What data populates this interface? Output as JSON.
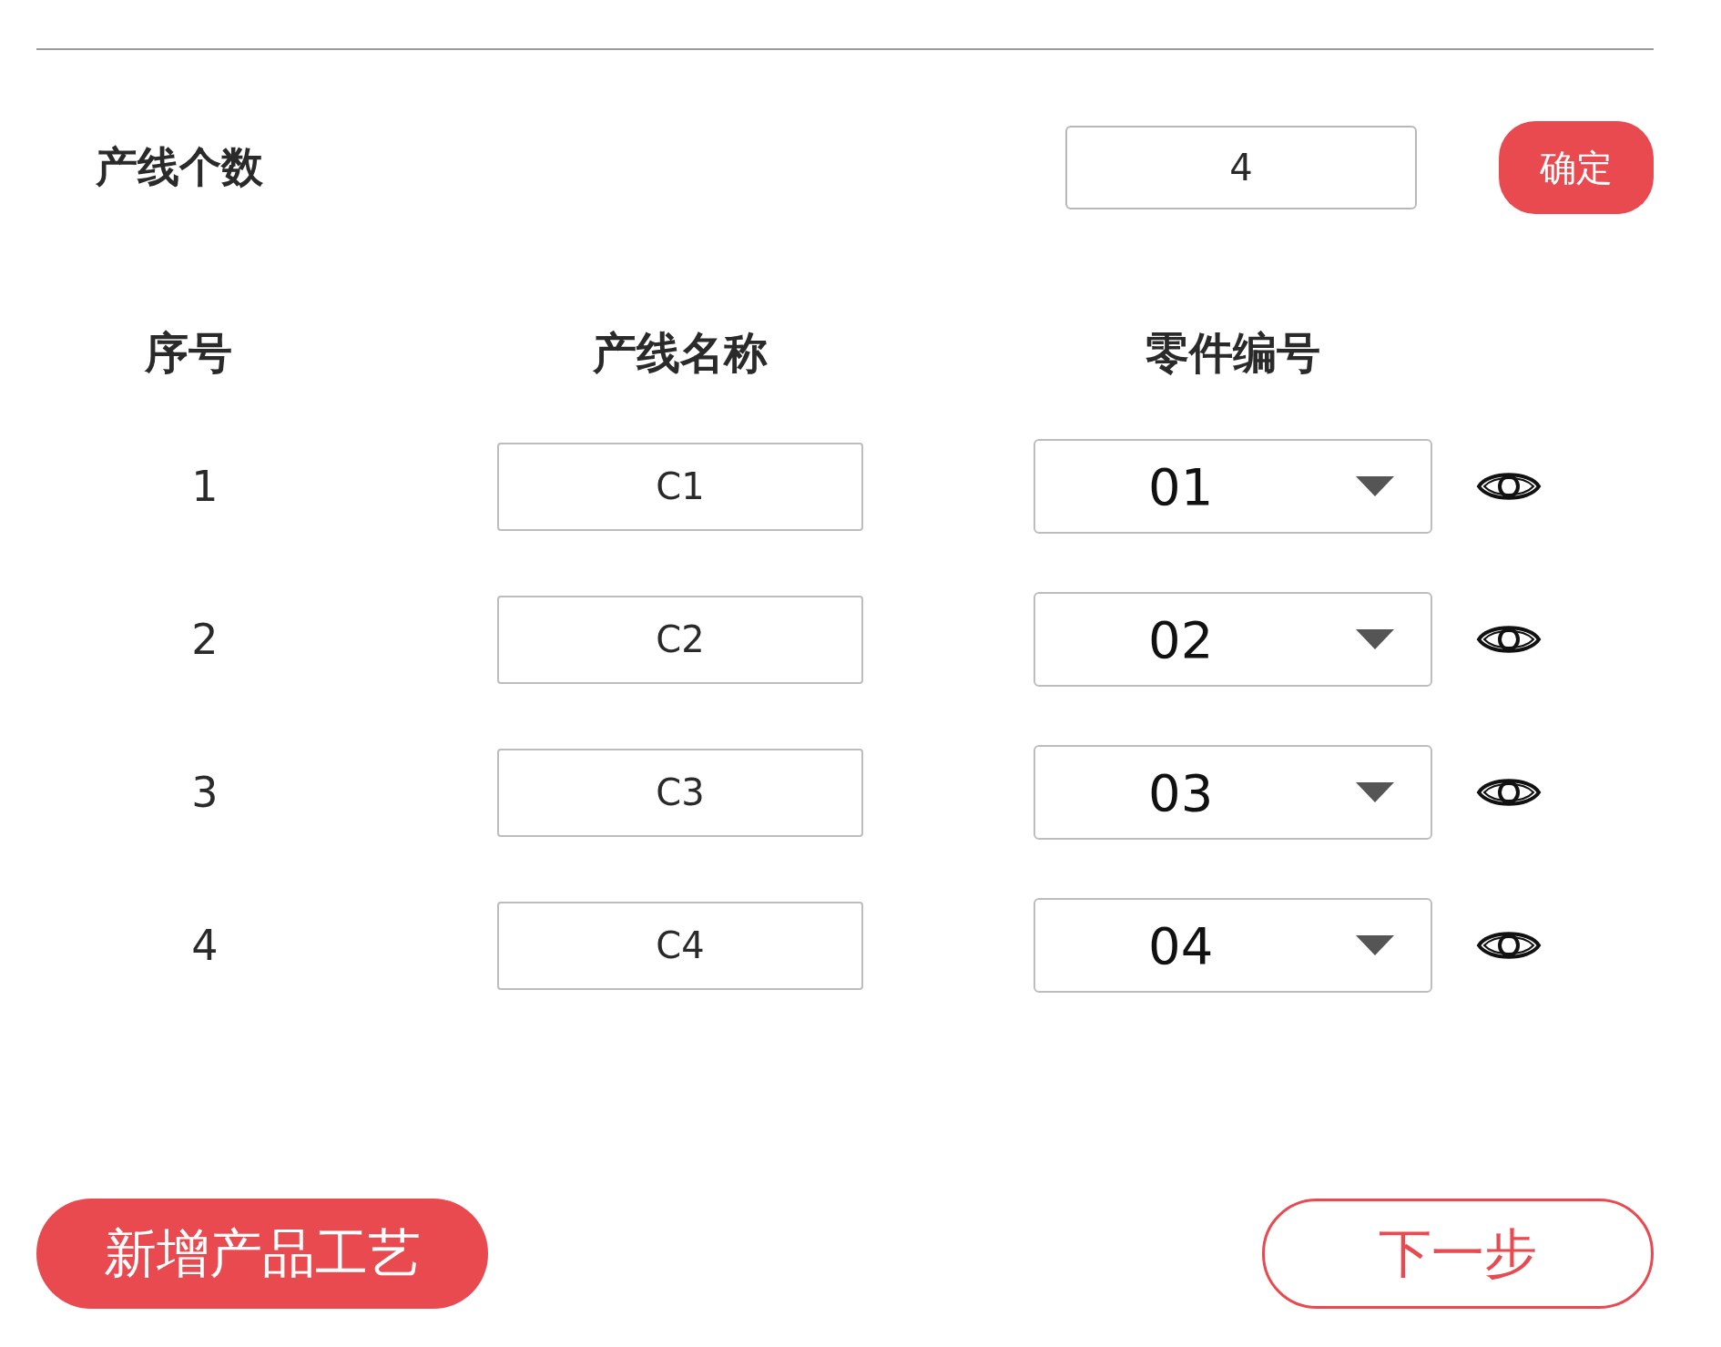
{
  "line_count": {
    "label": "产线个数",
    "value": "4"
  },
  "confirm_button": "确定",
  "table": {
    "columns": [
      "序号",
      "产线名称",
      "零件编号"
    ],
    "rows": [
      {
        "index": "1",
        "name": "C1",
        "part": "01"
      },
      {
        "index": "2",
        "name": "C2",
        "part": "02"
      },
      {
        "index": "3",
        "name": "C3",
        "part": "03"
      },
      {
        "index": "4",
        "name": "C4",
        "part": "04"
      }
    ]
  },
  "add_button": "新增产品工艺",
  "next_button": "下一步"
}
